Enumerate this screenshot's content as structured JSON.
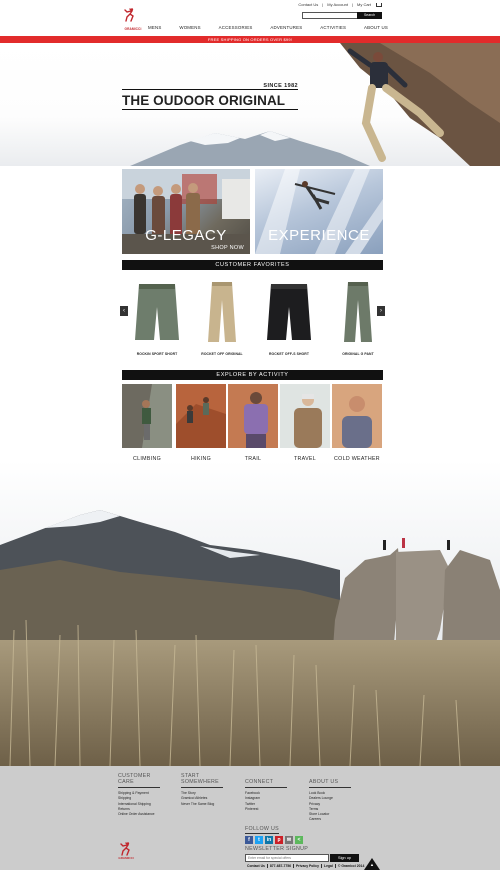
{
  "util": {
    "contact": "Contact Us",
    "account": "My Account",
    "cart": "My Cart"
  },
  "search": {
    "placeholder": "",
    "button": "Search"
  },
  "nav": [
    "MENS",
    "WOMENS",
    "ACCESSORIES",
    "ADVENTURES",
    "ACTIVITIES",
    "ABOUT US"
  ],
  "promo": "FREE SHIPPING ON ORDERS OVER $99!",
  "hero": {
    "since": "SINCE 1982",
    "tagline": "THE OUDOOR ORIGINAL"
  },
  "tiles": {
    "legacy_big": "G-LEGACY",
    "legacy_small": "SHOP NOW",
    "experience": "EXPERIENCE"
  },
  "favorites": {
    "title": "CUSTOMER FAVORITES",
    "prev": "‹",
    "next": "›",
    "items": [
      {
        "name": "ROCKIN SPORT SHORT",
        "color": "#6e7d6c"
      },
      {
        "name": "ROCKET OFF ORIGINAL",
        "color": "#c8b48e"
      },
      {
        "name": "ROCKET OFF-S SHORT",
        "color": "#1d1d1f"
      },
      {
        "name": "ORIGINAL G PANT",
        "color": "#6d7a69"
      }
    ]
  },
  "activities": {
    "title": "EXPLORE BY ACTIVITY",
    "items": [
      "CLIMBING",
      "HIKING",
      "TRAIL",
      "TRAVEL",
      "COLD WEATHER"
    ]
  },
  "footer": {
    "cols": [
      {
        "head1": "CUSTOMER",
        "head2": "CARE",
        "links": [
          "Shipping & Payment",
          "Shipping",
          "International Shipping",
          "Returns",
          "Online Order Assistance"
        ]
      },
      {
        "head1": "START",
        "head2": "SOMEWHERE",
        "links": [
          "The Story",
          "Gramicci Athletes",
          "Never The Same Blog"
        ]
      },
      {
        "head1": "CONNECT",
        "head2": "",
        "links": [
          "Facebook",
          "Instagram",
          "Twitter",
          "Pinterest"
        ]
      },
      {
        "head1": "ABOUT US",
        "head2": "",
        "links": [
          "Look Book",
          "Dealers Lounge",
          "Privacy",
          "Terms",
          "Store Locator",
          "Careers"
        ]
      }
    ],
    "follow": "FOLLOW US",
    "socials": [
      {
        "name": "facebook-icon",
        "glyph": "f",
        "color": "#3b5998"
      },
      {
        "name": "twitter-icon",
        "glyph": "t",
        "color": "#1da1f2"
      },
      {
        "name": "linkedin-icon",
        "glyph": "in",
        "color": "#0e76a8"
      },
      {
        "name": "pinterest-icon",
        "glyph": "p",
        "color": "#cb2027"
      },
      {
        "name": "email-icon",
        "glyph": "✉",
        "color": "#777777"
      },
      {
        "name": "share-icon",
        "glyph": "<",
        "color": "#5cb85c"
      }
    ],
    "newsletter": "NEWSLETTER SIGNUP",
    "news_placeholder": "Enter email for special offers",
    "news_button": "Sign up",
    "bottom": [
      "Contact Us",
      "877-687-7756",
      "Privacy Policy",
      "Legal",
      "© Gramicci 2014"
    ],
    "to_top": "▲"
  }
}
